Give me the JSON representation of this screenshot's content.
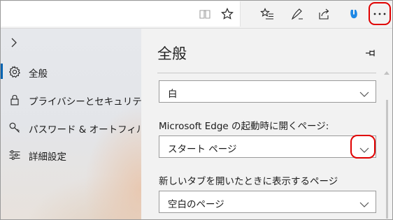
{
  "toolbar": {
    "icons": [
      "reading-view-icon",
      "favorite-star-icon",
      "favorites-list-icon",
      "web-note-icon",
      "share-icon",
      "extension-icon",
      "more-icon"
    ]
  },
  "sidebar": {
    "items": [
      {
        "label": "全般",
        "icon": "gear-icon",
        "selected": true
      },
      {
        "label": "プライバシーとセキュリティ",
        "icon": "lock-icon",
        "selected": false
      },
      {
        "label": "パスワード & オートフィル",
        "icon": "key-icon",
        "selected": false
      },
      {
        "label": "詳細設定",
        "icon": "sliders-icon",
        "selected": false
      }
    ]
  },
  "panel": {
    "title": "全般",
    "theme_select": {
      "value": "白"
    },
    "startup": {
      "label": "Microsoft Edge の起動時に開くページ:",
      "value": "スタート ページ"
    },
    "newtab": {
      "label": "新しいタブを開いたときに表示するページ",
      "value": "空白のページ"
    }
  },
  "colors": {
    "accent": "#0063b1",
    "highlight": "#e00000",
    "panel_bg": "#f2f2f2"
  }
}
